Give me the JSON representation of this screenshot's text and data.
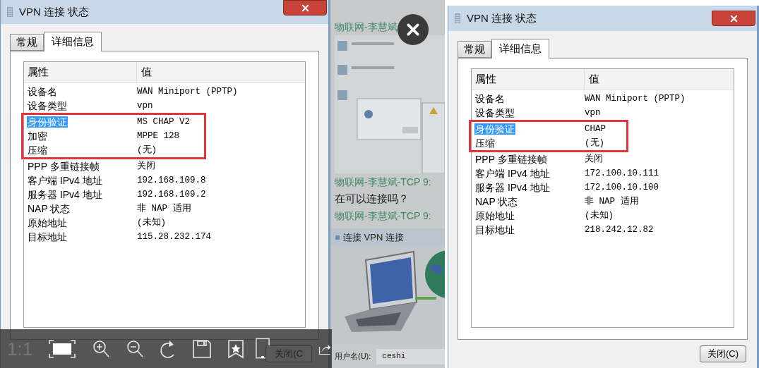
{
  "dialogs": [
    {
      "title": "VPN 连接 状态",
      "tabs": [
        {
          "label": "常规",
          "selected": false
        },
        {
          "label": "详细信息",
          "selected": true
        }
      ],
      "columns": [
        "属性",
        "值"
      ],
      "rows": [
        {
          "property": "设备名",
          "value": "WAN Miniport (PPTP)",
          "selected": false,
          "marked": false
        },
        {
          "property": "设备类型",
          "value": "vpn",
          "selected": false,
          "marked": false
        },
        {
          "property": "身份验证",
          "value": "MS CHAP V2",
          "selected": true,
          "marked": true
        },
        {
          "property": "加密",
          "value": "MPPE 128",
          "selected": false,
          "marked": true
        },
        {
          "property": "压缩",
          "value": "(无)",
          "selected": false,
          "marked": true
        },
        {
          "property": "PPP 多重链接帧",
          "value": "关闭",
          "selected": false,
          "marked": false
        },
        {
          "property": "客户端 IPv4 地址",
          "value": "192.168.109.8",
          "selected": false,
          "marked": false
        },
        {
          "property": "服务器 IPv4 地址",
          "value": "192.168.109.2",
          "selected": false,
          "marked": false
        },
        {
          "property": "NAP 状态",
          "value": "非 NAP 适用",
          "selected": false,
          "marked": false
        },
        {
          "property": "原始地址",
          "value": "(未知)",
          "selected": false,
          "marked": false
        },
        {
          "property": "目标地址",
          "value": "115.28.232.174",
          "selected": false,
          "marked": false
        }
      ],
      "close_button": "关闭(C"
    },
    {
      "title": "VPN 连接 状态",
      "tabs": [
        {
          "label": "常规",
          "selected": false
        },
        {
          "label": "详细信息",
          "selected": true
        }
      ],
      "columns": [
        "属性",
        "值"
      ],
      "rows": [
        {
          "property": "设备名",
          "value": "WAN Miniport (PPTP)",
          "selected": false,
          "marked": false
        },
        {
          "property": "设备类型",
          "value": "vpn",
          "selected": false,
          "marked": false
        },
        {
          "property": "身份验证",
          "value": "CHAP",
          "selected": true,
          "marked": true
        },
        {
          "property": "压缩",
          "value": "(无)",
          "selected": false,
          "marked": true
        },
        {
          "property": "PPP 多重链接帧",
          "value": "关闭",
          "selected": false,
          "marked": false
        },
        {
          "property": "客户端 IPv4 地址",
          "value": "172.100.10.111",
          "selected": false,
          "marked": false
        },
        {
          "property": "服务器 IPv4 地址",
          "value": "172.100.10.100",
          "selected": false,
          "marked": false
        },
        {
          "property": "NAP 状态",
          "value": "非 NAP 适用",
          "selected": false,
          "marked": false
        },
        {
          "property": "原始地址",
          "value": "(未知)",
          "selected": false,
          "marked": false
        },
        {
          "property": "目标地址",
          "value": "218.242.12.82",
          "selected": false,
          "marked": false
        }
      ],
      "close_button": "关闭(C)"
    }
  ],
  "chat": {
    "messages": [
      {
        "kind": "sender",
        "text": "物联网-李慧斌"
      },
      {
        "kind": "picture"
      },
      {
        "kind": "sender",
        "text": "物联网-李慧斌-TCP 9:"
      },
      {
        "kind": "message",
        "text": "在可以连接吗？"
      },
      {
        "kind": "sender",
        "text": "物联网-李慧斌-TCP 9:"
      }
    ],
    "dialog_title": "连接 VPN 连接",
    "username_label": "用户名(U):",
    "username": "ceshi"
  },
  "viewer": {
    "zoom_label": "1:1"
  }
}
